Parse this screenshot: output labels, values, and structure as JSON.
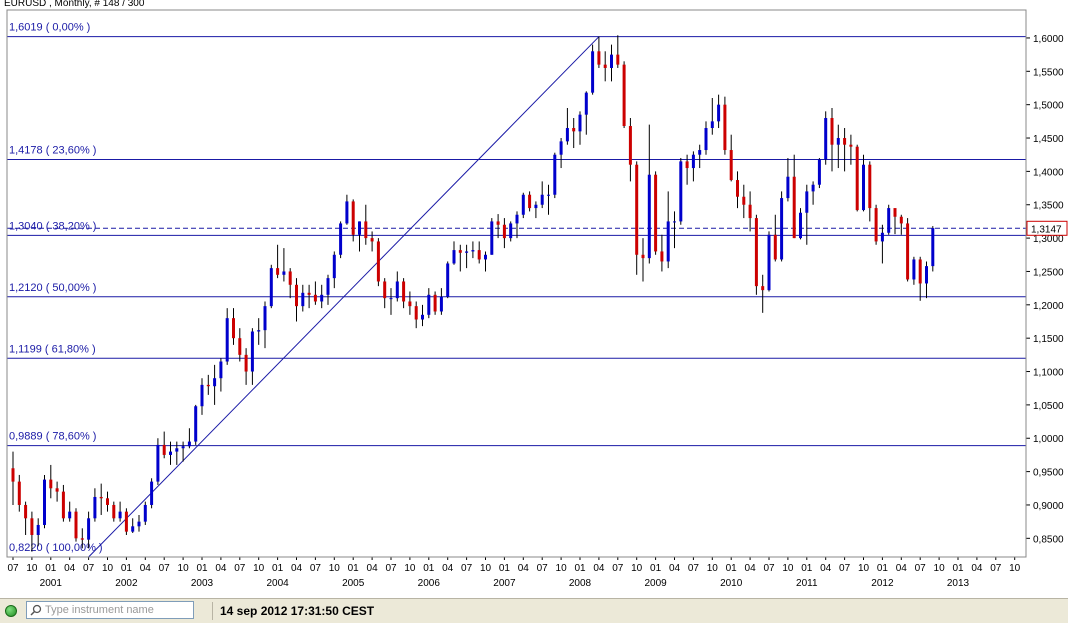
{
  "chart_data": {
    "type": "candlestick",
    "title": "EURUSD , Monthly, # 148 / 300",
    "ylim": [
      0.822,
      1.6419
    ],
    "y_ticks": [
      "1,6000",
      "1,5500",
      "1,5000",
      "1,4500",
      "1,4000",
      "1,3500",
      "1,3000",
      "1,2500",
      "1,2000",
      "1,1500",
      "1,1000",
      "1,0500",
      "1,0000",
      "0,9500",
      "0,9000",
      "0,8500"
    ],
    "y_tick_values": [
      1.6,
      1.55,
      1.5,
      1.45,
      1.4,
      1.35,
      1.3,
      1.25,
      1.2,
      1.15,
      1.1,
      1.05,
      1.0,
      0.95,
      0.9,
      0.85
    ],
    "x_month_ticks": [
      "07",
      "10",
      "01",
      "04",
      "07",
      "10",
      "01",
      "04",
      "07",
      "10",
      "01",
      "04",
      "07",
      "10",
      "01",
      "04",
      "07",
      "10",
      "01",
      "04",
      "07",
      "10",
      "01",
      "04",
      "07",
      "10",
      "01",
      "04",
      "07",
      "10",
      "01",
      "04",
      "07",
      "10",
      "01",
      "04",
      "07",
      "10",
      "01",
      "04",
      "07",
      "10",
      "01",
      "04",
      "07",
      "10",
      "01",
      "04",
      "07",
      "10",
      "01",
      "04",
      "07",
      "10"
    ],
    "x_years": [
      "2001",
      "2002",
      "2003",
      "2004",
      "2005",
      "2006",
      "2007",
      "2008",
      "2009",
      "2010",
      "2011",
      "2012",
      "2013"
    ],
    "start": "2000-07",
    "current_price": "1,3147",
    "current_price_value": 1.3147,
    "fib_levels": [
      {
        "label": "1,6019 ( 0,00% )",
        "value": 1.6019
      },
      {
        "label": "1,4178 ( 23,60% )",
        "value": 1.4178
      },
      {
        "label": "1,3040 ( 38,20% )",
        "value": 1.304
      },
      {
        "label": "1,2120 ( 50,00% )",
        "value": 1.212
      },
      {
        "label": "1,1199 ( 61,80% )",
        "value": 1.1199
      },
      {
        "label": "0,9889 ( 78,60% )",
        "value": 0.9889
      },
      {
        "label": "0,8220 ( 100,00% )",
        "value": 0.822
      }
    ],
    "fib_trendline": {
      "from": [
        "2001-07",
        0.822
      ],
      "to": [
        "2008-04",
        1.6019
      ]
    },
    "candles": [
      {
        "d": "2000-07",
        "o": 0.955,
        "h": 0.98,
        "l": 0.9,
        "c": 0.935
      },
      {
        "d": "2000-08",
        "o": 0.935,
        "h": 0.945,
        "l": 0.89,
        "c": 0.9
      },
      {
        "d": "2000-09",
        "o": 0.9,
        "h": 0.905,
        "l": 0.855,
        "c": 0.88
      },
      {
        "d": "2000-10",
        "o": 0.88,
        "h": 0.89,
        "l": 0.83,
        "c": 0.855
      },
      {
        "d": "2000-11",
        "o": 0.855,
        "h": 0.88,
        "l": 0.838,
        "c": 0.87
      },
      {
        "d": "2000-12",
        "o": 0.87,
        "h": 0.945,
        "l": 0.865,
        "c": 0.938
      },
      {
        "d": "2001-01",
        "o": 0.938,
        "h": 0.96,
        "l": 0.91,
        "c": 0.925
      },
      {
        "d": "2001-02",
        "o": 0.925,
        "h": 0.935,
        "l": 0.905,
        "c": 0.92
      },
      {
        "d": "2001-03",
        "o": 0.92,
        "h": 0.93,
        "l": 0.875,
        "c": 0.88
      },
      {
        "d": "2001-04",
        "o": 0.88,
        "h": 0.905,
        "l": 0.875,
        "c": 0.89
      },
      {
        "d": "2001-05",
        "o": 0.89,
        "h": 0.895,
        "l": 0.845,
        "c": 0.85
      },
      {
        "d": "2001-06",
        "o": 0.85,
        "h": 0.865,
        "l": 0.835,
        "c": 0.848
      },
      {
        "d": "2001-07",
        "o": 0.848,
        "h": 0.89,
        "l": 0.835,
        "c": 0.88
      },
      {
        "d": "2001-08",
        "o": 0.88,
        "h": 0.925,
        "l": 0.875,
        "c": 0.912
      },
      {
        "d": "2001-09",
        "o": 0.912,
        "h": 0.932,
        "l": 0.885,
        "c": 0.91
      },
      {
        "d": "2001-10",
        "o": 0.91,
        "h": 0.92,
        "l": 0.89,
        "c": 0.9
      },
      {
        "d": "2001-11",
        "o": 0.9,
        "h": 0.905,
        "l": 0.875,
        "c": 0.88
      },
      {
        "d": "2001-12",
        "o": 0.88,
        "h": 0.905,
        "l": 0.875,
        "c": 0.89
      },
      {
        "d": "2002-01",
        "o": 0.89,
        "h": 0.895,
        "l": 0.855,
        "c": 0.86
      },
      {
        "d": "2002-02",
        "o": 0.86,
        "h": 0.88,
        "l": 0.858,
        "c": 0.868
      },
      {
        "d": "2002-03",
        "o": 0.868,
        "h": 0.885,
        "l": 0.86,
        "c": 0.875
      },
      {
        "d": "2002-04",
        "o": 0.875,
        "h": 0.905,
        "l": 0.87,
        "c": 0.9
      },
      {
        "d": "2002-05",
        "o": 0.9,
        "h": 0.94,
        "l": 0.895,
        "c": 0.935
      },
      {
        "d": "2002-06",
        "o": 0.935,
        "h": 1.0,
        "l": 0.93,
        "c": 0.99
      },
      {
        "d": "2002-07",
        "o": 0.99,
        "h": 1.01,
        "l": 0.97,
        "c": 0.975
      },
      {
        "d": "2002-08",
        "o": 0.975,
        "h": 0.995,
        "l": 0.96,
        "c": 0.98
      },
      {
        "d": "2002-09",
        "o": 0.98,
        "h": 0.995,
        "l": 0.96,
        "c": 0.985
      },
      {
        "d": "2002-10",
        "o": 0.985,
        "h": 0.995,
        "l": 0.965,
        "c": 0.988
      },
      {
        "d": "2002-11",
        "o": 0.988,
        "h": 1.015,
        "l": 0.985,
        "c": 0.995
      },
      {
        "d": "2002-12",
        "o": 0.995,
        "h": 1.05,
        "l": 0.99,
        "c": 1.048
      },
      {
        "d": "2003-01",
        "o": 1.048,
        "h": 1.09,
        "l": 1.035,
        "c": 1.08
      },
      {
        "d": "2003-02",
        "o": 1.08,
        "h": 1.095,
        "l": 1.065,
        "c": 1.078
      },
      {
        "d": "2003-03",
        "o": 1.078,
        "h": 1.11,
        "l": 1.05,
        "c": 1.09
      },
      {
        "d": "2003-04",
        "o": 1.09,
        "h": 1.12,
        "l": 1.07,
        "c": 1.115
      },
      {
        "d": "2003-05",
        "o": 1.115,
        "h": 1.195,
        "l": 1.11,
        "c": 1.18
      },
      {
        "d": "2003-06",
        "o": 1.18,
        "h": 1.195,
        "l": 1.14,
        "c": 1.15
      },
      {
        "d": "2003-07",
        "o": 1.15,
        "h": 1.165,
        "l": 1.115,
        "c": 1.125
      },
      {
        "d": "2003-08",
        "o": 1.125,
        "h": 1.135,
        "l": 1.08,
        "c": 1.1
      },
      {
        "d": "2003-09",
        "o": 1.1,
        "h": 1.165,
        "l": 1.08,
        "c": 1.16
      },
      {
        "d": "2003-10",
        "o": 1.16,
        "h": 1.18,
        "l": 1.14,
        "c": 1.162
      },
      {
        "d": "2003-11",
        "o": 1.162,
        "h": 1.205,
        "l": 1.135,
        "c": 1.198
      },
      {
        "d": "2003-12",
        "o": 1.198,
        "h": 1.26,
        "l": 1.195,
        "c": 1.255
      },
      {
        "d": "2004-01",
        "o": 1.255,
        "h": 1.29,
        "l": 1.24,
        "c": 1.245
      },
      {
        "d": "2004-02",
        "o": 1.245,
        "h": 1.285,
        "l": 1.235,
        "c": 1.25
      },
      {
        "d": "2004-03",
        "o": 1.25,
        "h": 1.255,
        "l": 1.21,
        "c": 1.23
      },
      {
        "d": "2004-04",
        "o": 1.23,
        "h": 1.24,
        "l": 1.175,
        "c": 1.198
      },
      {
        "d": "2004-05",
        "o": 1.198,
        "h": 1.23,
        "l": 1.19,
        "c": 1.218
      },
      {
        "d": "2004-06",
        "o": 1.218,
        "h": 1.23,
        "l": 1.195,
        "c": 1.215
      },
      {
        "d": "2004-07",
        "o": 1.215,
        "h": 1.235,
        "l": 1.2,
        "c": 1.205
      },
      {
        "d": "2004-08",
        "o": 1.205,
        "h": 1.23,
        "l": 1.195,
        "c": 1.215
      },
      {
        "d": "2004-09",
        "o": 1.215,
        "h": 1.245,
        "l": 1.2,
        "c": 1.24
      },
      {
        "d": "2004-10",
        "o": 1.24,
        "h": 1.28,
        "l": 1.225,
        "c": 1.275
      },
      {
        "d": "2004-11",
        "o": 1.275,
        "h": 1.325,
        "l": 1.27,
        "c": 1.322
      },
      {
        "d": "2004-12",
        "o": 1.322,
        "h": 1.365,
        "l": 1.32,
        "c": 1.355
      },
      {
        "d": "2005-01",
        "o": 1.355,
        "h": 1.358,
        "l": 1.295,
        "c": 1.305
      },
      {
        "d": "2005-02",
        "o": 1.305,
        "h": 1.325,
        "l": 1.28,
        "c": 1.325
      },
      {
        "d": "2005-03",
        "o": 1.325,
        "h": 1.35,
        "l": 1.29,
        "c": 1.3
      },
      {
        "d": "2005-04",
        "o": 1.3,
        "h": 1.31,
        "l": 1.28,
        "c": 1.295
      },
      {
        "d": "2005-05",
        "o": 1.295,
        "h": 1.3,
        "l": 1.228,
        "c": 1.235
      },
      {
        "d": "2005-06",
        "o": 1.235,
        "h": 1.24,
        "l": 1.195,
        "c": 1.21
      },
      {
        "d": "2005-07",
        "o": 1.21,
        "h": 1.225,
        "l": 1.185,
        "c": 1.21
      },
      {
        "d": "2005-08",
        "o": 1.21,
        "h": 1.25,
        "l": 1.205,
        "c": 1.235
      },
      {
        "d": "2005-09",
        "o": 1.235,
        "h": 1.24,
        "l": 1.195,
        "c": 1.205
      },
      {
        "d": "2005-10",
        "o": 1.205,
        "h": 1.22,
        "l": 1.185,
        "c": 1.198
      },
      {
        "d": "2005-11",
        "o": 1.198,
        "h": 1.205,
        "l": 1.165,
        "c": 1.178
      },
      {
        "d": "2005-12",
        "o": 1.178,
        "h": 1.2,
        "l": 1.168,
        "c": 1.185
      },
      {
        "d": "2006-01",
        "o": 1.185,
        "h": 1.225,
        "l": 1.18,
        "c": 1.215
      },
      {
        "d": "2006-02",
        "o": 1.215,
        "h": 1.22,
        "l": 1.185,
        "c": 1.19
      },
      {
        "d": "2006-03",
        "o": 1.19,
        "h": 1.225,
        "l": 1.185,
        "c": 1.212
      },
      {
        "d": "2006-04",
        "o": 1.212,
        "h": 1.265,
        "l": 1.21,
        "c": 1.262
      },
      {
        "d": "2006-05",
        "o": 1.262,
        "h": 1.295,
        "l": 1.26,
        "c": 1.282
      },
      {
        "d": "2006-06",
        "o": 1.282,
        "h": 1.29,
        "l": 1.25,
        "c": 1.278
      },
      {
        "d": "2006-07",
        "o": 1.278,
        "h": 1.29,
        "l": 1.255,
        "c": 1.28
      },
      {
        "d": "2006-08",
        "o": 1.28,
        "h": 1.295,
        "l": 1.27,
        "c": 1.282
      },
      {
        "d": "2006-09",
        "o": 1.282,
        "h": 1.295,
        "l": 1.262,
        "c": 1.268
      },
      {
        "d": "2006-10",
        "o": 1.268,
        "h": 1.28,
        "l": 1.25,
        "c": 1.275
      },
      {
        "d": "2006-11",
        "o": 1.275,
        "h": 1.33,
        "l": 1.275,
        "c": 1.325
      },
      {
        "d": "2006-12",
        "o": 1.325,
        "h": 1.336,
        "l": 1.3,
        "c": 1.32
      },
      {
        "d": "2007-01",
        "o": 1.32,
        "h": 1.33,
        "l": 1.285,
        "c": 1.3
      },
      {
        "d": "2007-02",
        "o": 1.3,
        "h": 1.325,
        "l": 1.295,
        "c": 1.322
      },
      {
        "d": "2007-03",
        "o": 1.322,
        "h": 1.34,
        "l": 1.3,
        "c": 1.335
      },
      {
        "d": "2007-04",
        "o": 1.335,
        "h": 1.368,
        "l": 1.33,
        "c": 1.365
      },
      {
        "d": "2007-05",
        "o": 1.365,
        "h": 1.37,
        "l": 1.34,
        "c": 1.345
      },
      {
        "d": "2007-06",
        "o": 1.345,
        "h": 1.355,
        "l": 1.33,
        "c": 1.35
      },
      {
        "d": "2007-07",
        "o": 1.35,
        "h": 1.385,
        "l": 1.345,
        "c": 1.365
      },
      {
        "d": "2007-08",
        "o": 1.365,
        "h": 1.38,
        "l": 1.335,
        "c": 1.365
      },
      {
        "d": "2007-09",
        "o": 1.365,
        "h": 1.428,
        "l": 1.36,
        "c": 1.425
      },
      {
        "d": "2007-10",
        "o": 1.425,
        "h": 1.45,
        "l": 1.405,
        "c": 1.445
      },
      {
        "d": "2007-11",
        "o": 1.445,
        "h": 1.495,
        "l": 1.44,
        "c": 1.465
      },
      {
        "d": "2007-12",
        "o": 1.465,
        "h": 1.48,
        "l": 1.435,
        "c": 1.46
      },
      {
        "d": "2008-01",
        "o": 1.46,
        "h": 1.49,
        "l": 1.44,
        "c": 1.485
      },
      {
        "d": "2008-02",
        "o": 1.485,
        "h": 1.52,
        "l": 1.455,
        "c": 1.518
      },
      {
        "d": "2008-03",
        "o": 1.518,
        "h": 1.59,
        "l": 1.515,
        "c": 1.58
      },
      {
        "d": "2008-04",
        "o": 1.58,
        "h": 1.602,
        "l": 1.555,
        "c": 1.56
      },
      {
        "d": "2008-05",
        "o": 1.56,
        "h": 1.58,
        "l": 1.535,
        "c": 1.555
      },
      {
        "d": "2008-06",
        "o": 1.555,
        "h": 1.59,
        "l": 1.535,
        "c": 1.575
      },
      {
        "d": "2008-07",
        "o": 1.575,
        "h": 1.604,
        "l": 1.555,
        "c": 1.56
      },
      {
        "d": "2008-08",
        "o": 1.56,
        "h": 1.565,
        "l": 1.465,
        "c": 1.468
      },
      {
        "d": "2008-09",
        "o": 1.468,
        "h": 1.48,
        "l": 1.385,
        "c": 1.41
      },
      {
        "d": "2008-10",
        "o": 1.41,
        "h": 1.415,
        "l": 1.245,
        "c": 1.275
      },
      {
        "d": "2008-11",
        "o": 1.275,
        "h": 1.3,
        "l": 1.235,
        "c": 1.27
      },
      {
        "d": "2008-12",
        "o": 1.27,
        "h": 1.47,
        "l": 1.262,
        "c": 1.395
      },
      {
        "d": "2009-01",
        "o": 1.395,
        "h": 1.4,
        "l": 1.275,
        "c": 1.28
      },
      {
        "d": "2009-02",
        "o": 1.28,
        "h": 1.305,
        "l": 1.25,
        "c": 1.265
      },
      {
        "d": "2009-03",
        "o": 1.265,
        "h": 1.37,
        "l": 1.255,
        "c": 1.325
      },
      {
        "d": "2009-04",
        "o": 1.325,
        "h": 1.34,
        "l": 1.285,
        "c": 1.325
      },
      {
        "d": "2009-05",
        "o": 1.325,
        "h": 1.42,
        "l": 1.32,
        "c": 1.415
      },
      {
        "d": "2009-06",
        "o": 1.415,
        "h": 1.425,
        "l": 1.38,
        "c": 1.405
      },
      {
        "d": "2009-07",
        "o": 1.405,
        "h": 1.43,
        "l": 1.385,
        "c": 1.425
      },
      {
        "d": "2009-08",
        "o": 1.425,
        "h": 1.44,
        "l": 1.405,
        "c": 1.432
      },
      {
        "d": "2009-09",
        "o": 1.432,
        "h": 1.475,
        "l": 1.425,
        "c": 1.465
      },
      {
        "d": "2009-10",
        "o": 1.465,
        "h": 1.51,
        "l": 1.455,
        "c": 1.475
      },
      {
        "d": "2009-11",
        "o": 1.475,
        "h": 1.515,
        "l": 1.465,
        "c": 1.5
      },
      {
        "d": "2009-12",
        "o": 1.5,
        "h": 1.512,
        "l": 1.425,
        "c": 1.432
      },
      {
        "d": "2010-01",
        "o": 1.432,
        "h": 1.455,
        "l": 1.385,
        "c": 1.387
      },
      {
        "d": "2010-02",
        "o": 1.387,
        "h": 1.4,
        "l": 1.345,
        "c": 1.362
      },
      {
        "d": "2010-03",
        "o": 1.362,
        "h": 1.38,
        "l": 1.33,
        "c": 1.35
      },
      {
        "d": "2010-04",
        "o": 1.35,
        "h": 1.37,
        "l": 1.31,
        "c": 1.33
      },
      {
        "d": "2010-05",
        "o": 1.33,
        "h": 1.335,
        "l": 1.215,
        "c": 1.228
      },
      {
        "d": "2010-06",
        "o": 1.228,
        "h": 1.245,
        "l": 1.188,
        "c": 1.222
      },
      {
        "d": "2010-07",
        "o": 1.222,
        "h": 1.31,
        "l": 1.22,
        "c": 1.305
      },
      {
        "d": "2010-08",
        "o": 1.305,
        "h": 1.335,
        "l": 1.265,
        "c": 1.268
      },
      {
        "d": "2010-09",
        "o": 1.268,
        "h": 1.37,
        "l": 1.265,
        "c": 1.36
      },
      {
        "d": "2010-10",
        "o": 1.36,
        "h": 1.42,
        "l": 1.355,
        "c": 1.392
      },
      {
        "d": "2010-11",
        "o": 1.392,
        "h": 1.425,
        "l": 1.3,
        "c": 1.3
      },
      {
        "d": "2010-12",
        "o": 1.3,
        "h": 1.345,
        "l": 1.298,
        "c": 1.338
      },
      {
        "d": "2011-01",
        "o": 1.338,
        "h": 1.38,
        "l": 1.29,
        "c": 1.37
      },
      {
        "d": "2011-02",
        "o": 1.37,
        "h": 1.385,
        "l": 1.35,
        "c": 1.38
      },
      {
        "d": "2011-03",
        "o": 1.38,
        "h": 1.42,
        "l": 1.375,
        "c": 1.418
      },
      {
        "d": "2011-04",
        "o": 1.418,
        "h": 1.49,
        "l": 1.41,
        "c": 1.48
      },
      {
        "d": "2011-05",
        "o": 1.48,
        "h": 1.495,
        "l": 1.4,
        "c": 1.44
      },
      {
        "d": "2011-06",
        "o": 1.44,
        "h": 1.47,
        "l": 1.405,
        "c": 1.45
      },
      {
        "d": "2011-07",
        "o": 1.45,
        "h": 1.465,
        "l": 1.4,
        "c": 1.44
      },
      {
        "d": "2011-08",
        "o": 1.44,
        "h": 1.455,
        "l": 1.41,
        "c": 1.437
      },
      {
        "d": "2011-09",
        "o": 1.437,
        "h": 1.44,
        "l": 1.34,
        "c": 1.342
      },
      {
        "d": "2011-10",
        "o": 1.342,
        "h": 1.425,
        "l": 1.34,
        "c": 1.41
      },
      {
        "d": "2011-11",
        "o": 1.41,
        "h": 1.415,
        "l": 1.325,
        "c": 1.345
      },
      {
        "d": "2011-12",
        "o": 1.345,
        "h": 1.35,
        "l": 1.29,
        "c": 1.295
      },
      {
        "d": "2012-01",
        "o": 1.295,
        "h": 1.32,
        "l": 1.262,
        "c": 1.308
      },
      {
        "d": "2012-02",
        "o": 1.308,
        "h": 1.35,
        "l": 1.305,
        "c": 1.345
      },
      {
        "d": "2012-03",
        "o": 1.345,
        "h": 1.342,
        "l": 1.306,
        "c": 1.332
      },
      {
        "d": "2012-04",
        "o": 1.332,
        "h": 1.335,
        "l": 1.305,
        "c": 1.322
      },
      {
        "d": "2012-05",
        "o": 1.322,
        "h": 1.33,
        "l": 1.235,
        "c": 1.238
      },
      {
        "d": "2012-06",
        "o": 1.238,
        "h": 1.272,
        "l": 1.23,
        "c": 1.268
      },
      {
        "d": "2012-07",
        "o": 1.268,
        "h": 1.272,
        "l": 1.206,
        "c": 1.232
      },
      {
        "d": "2012-08",
        "o": 1.232,
        "h": 1.265,
        "l": 1.21,
        "c": 1.258
      },
      {
        "d": "2012-09",
        "o": 1.258,
        "h": 1.318,
        "l": 1.25,
        "c": 1.315
      }
    ],
    "colors": {
      "up": "#0000cc",
      "down": "#cc0000",
      "line": "#1a1aa6",
      "current": "#cc0000"
    }
  },
  "statusbar": {
    "search_placeholder": "Type instrument name",
    "datetime": "14 sep 2012 17:31:50 CEST"
  }
}
